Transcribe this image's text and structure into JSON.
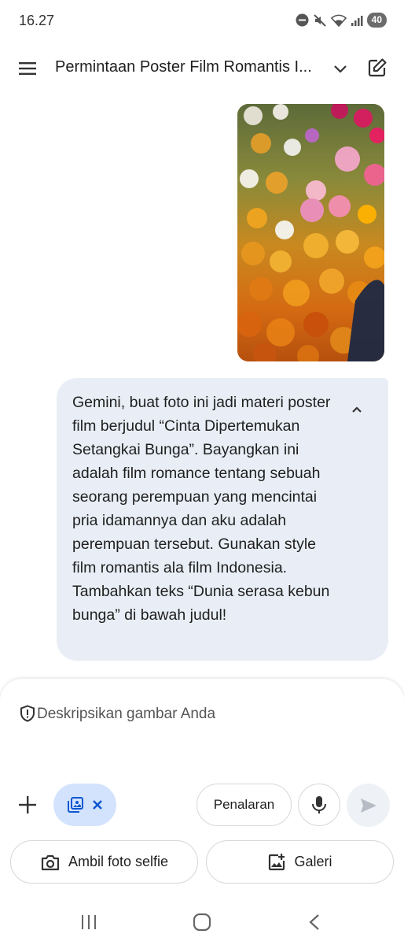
{
  "status_bar": {
    "time": "16.27",
    "battery": "40"
  },
  "header": {
    "conversation_title": "Permintaan Poster Film Romantis I..."
  },
  "chat": {
    "prompt_text": "Gemini, buat foto ini jadi materi poster film berjudul “Cinta Dipertemukan Setangkai Bunga”. Bayangkan ini adalah film romance tentang sebuah seorang perempuan yang mencintai pria idamannya dan aku adalah perempuan tersebut. Gunakan style film romantis ala film Indonesia. Tambahkan teks “Dunia serasa kebun bunga” di bawah judul!"
  },
  "composer": {
    "placeholder": "Deskripsikan gambar Anda",
    "reasoning_label": "Penalaran",
    "selfie_label": "Ambil foto selfie",
    "gallery_label": "Galeri"
  },
  "colors": {
    "bubble": "#e9eef6",
    "chip": "#d3e3fd",
    "accent": "#0b57d0"
  },
  "icons": [
    "menu-icon",
    "chevron-down-icon",
    "edit-icon",
    "chevron-up-icon",
    "shield-icon",
    "plus-icon",
    "image-stack-icon",
    "close-icon",
    "mic-icon",
    "send-icon",
    "camera-icon",
    "gallery-icon"
  ]
}
